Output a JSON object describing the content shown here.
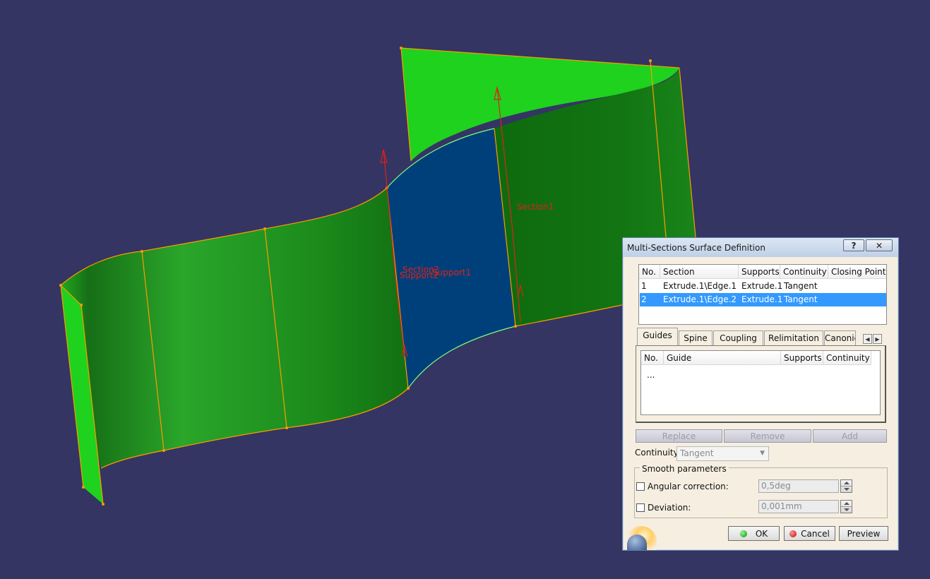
{
  "viewport": {
    "labels": {
      "section1": "Section1",
      "section2": "Section2",
      "support1": "Support1",
      "support2": "Support2"
    },
    "colors": {
      "background": "#343562",
      "surface": "#1f8f1f",
      "surface_light": "#1ed21e",
      "selected_face": "#00407a",
      "edge": "#ff9a00",
      "arrow": "#e0201a"
    }
  },
  "dialog": {
    "title": "Multi-Sections Surface Definition",
    "help_label": "?",
    "close_label": "✕",
    "sections": {
      "columns": [
        "No.",
        "Section",
        "Supports",
        "Continuity",
        "Closing Point"
      ],
      "rows": [
        {
          "no": "1",
          "section": "Extrude.1\\Edge.1",
          "supports": "Extrude.1",
          "continuity": "Tangent",
          "closing": ""
        },
        {
          "no": "2",
          "section": "Extrude.1\\Edge.2",
          "supports": "Extrude.1",
          "continuity": "Tangent",
          "closing": ""
        }
      ]
    },
    "tabs": [
      "Guides",
      "Spine",
      "Coupling",
      "Relimitation",
      "Canonic"
    ],
    "guides": {
      "columns": [
        "No.",
        "Guide",
        "Supports",
        "Continuity"
      ],
      "placeholder": "..."
    },
    "buttons": {
      "replace": "Replace",
      "remove": "Remove",
      "add": "Add",
      "ok": "OK",
      "cancel": "Cancel",
      "preview": "Preview"
    },
    "continuity": {
      "label": "Continuity:",
      "value": "Tangent"
    },
    "smooth": {
      "title": "Smooth parameters",
      "angular_label": "Angular correction:",
      "angular_value": "0,5deg",
      "deviation_label": "Deviation:",
      "deviation_value": "0,001mm"
    }
  }
}
